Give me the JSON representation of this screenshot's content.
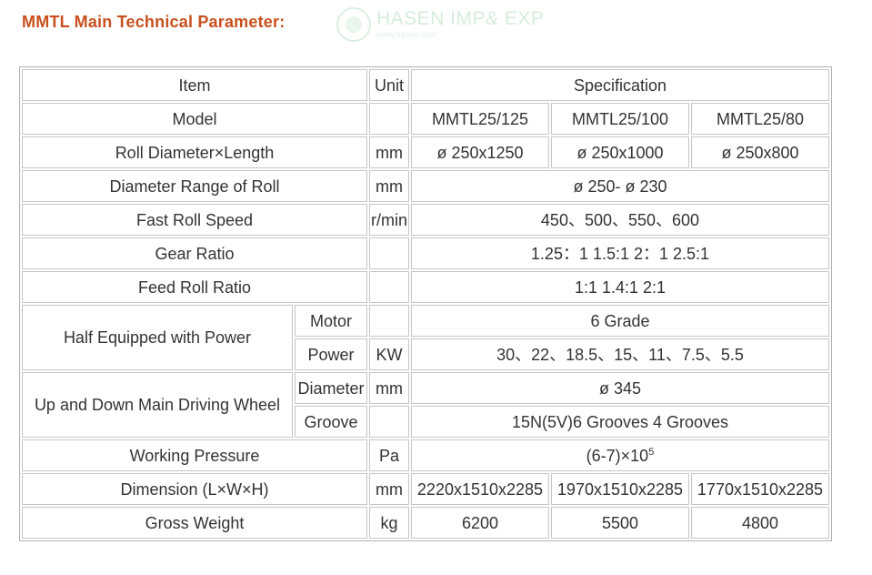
{
  "page": {
    "title": "MMTL Main Technical Parameter:",
    "watermark_text": "HASEN IMP& EXP",
    "watermark_subtext": "www.hasen.com"
  },
  "table": {
    "header": {
      "item": "Item",
      "unit": "Unit",
      "spec": "Specification"
    },
    "model": {
      "label": "Model",
      "unit": "",
      "values": [
        "MMTL25/125",
        "MMTL25/100",
        "MMTL25/80"
      ]
    },
    "roll_diameter_length": {
      "label": "Roll Diameter×Length",
      "unit": "mm",
      "values": [
        "ø 250x1250",
        "ø 250x1000",
        "ø 250x800"
      ]
    },
    "diameter_range": {
      "label": "Diameter Range of Roll",
      "unit": "mm",
      "value": "ø 250- ø 230"
    },
    "fast_roll_speed": {
      "label": "Fast Roll Speed",
      "unit": "r/min",
      "value": "450、500、550、600"
    },
    "gear_ratio": {
      "label": "Gear Ratio",
      "unit": "",
      "value": "1.25：1 1.5:1 2：1 2.5:1"
    },
    "feed_roll_ratio": {
      "label": "Feed Roll Ratio",
      "unit": "",
      "value": "1:1 1.4:1 2:1"
    },
    "half_equipped": {
      "label": "Half Equipped with Power",
      "motor": {
        "sublabel": "Motor",
        "unit": "",
        "value": "6 Grade"
      },
      "power": {
        "sublabel": "Power",
        "unit": "KW",
        "value": "30、22、18.5、15、11、7.5、5.5"
      }
    },
    "driving_wheel": {
      "label": "Up and Down Main Driving Wheel",
      "diameter": {
        "sublabel": "Diameter",
        "unit": "mm",
        "value": "ø 345"
      },
      "groove": {
        "sublabel": "Groove",
        "unit": "",
        "value": "15N(5V)6 Grooves 4 Grooves"
      }
    },
    "working_pressure": {
      "label": "Working Pressure",
      "unit": "Pa",
      "value_base": "(6-7)×10",
      "value_exp": "5"
    },
    "dimension": {
      "label": "Dimension (L×W×H)",
      "unit": "mm",
      "values": [
        "2220x1510x2285",
        "1970x1510x2285",
        "1770x1510x2285"
      ]
    },
    "gross_weight": {
      "label": "Gross Weight",
      "unit": "kg",
      "values": [
        "6200",
        "5500",
        "4800"
      ]
    }
  }
}
